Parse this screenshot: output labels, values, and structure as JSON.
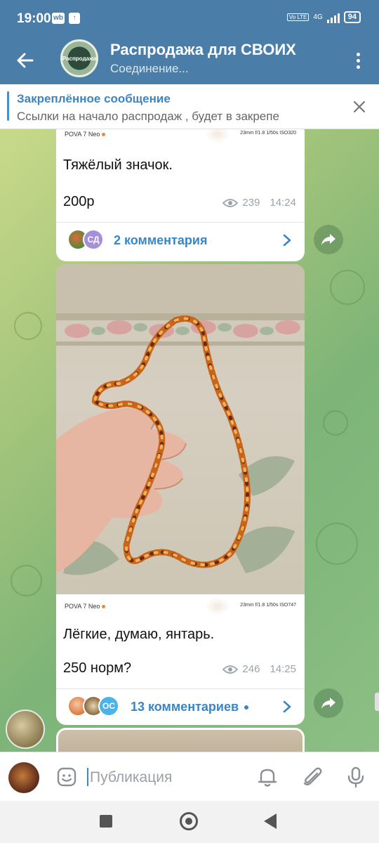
{
  "status_bar": {
    "time": "19:00",
    "app_icon_label": "wb",
    "network": "4G",
    "volte": "Vo LTE",
    "battery": "94"
  },
  "header": {
    "title": "Распродажа для СВОИХ",
    "subtitle": "Соединение...",
    "avatar_text": "Распродажа",
    "accent_color": "#4a7ea8"
  },
  "pinned": {
    "title": "Закреплённое сообщение",
    "text": "Ссылки на начало распродаж , будет в закрепе"
  },
  "messages": [
    {
      "photo_device": "POVA 7 Neo",
      "photo_exif": "23mm f/1.8 1/50s ISO320",
      "line1": "Тяжёлый значок.",
      "line2": "200р",
      "views": "239",
      "time": "14:24",
      "comment_avatar_initials": "СД",
      "comments_label": "2 комментария"
    },
    {
      "photo_device": "POVA 7 Neo",
      "photo_exif": "23mm f/1.8 1/50s ISO747",
      "line1": "Лёгкие, думаю, янтарь.",
      "line2": "250 норм?",
      "views": "246",
      "time": "14:25",
      "comment_avatar_initials": "ОС",
      "comments_label": "13 комментариев"
    }
  ],
  "input": {
    "placeholder": "Публикация"
  },
  "icons": {
    "back": "arrow-left-icon",
    "menu": "more-vertical-icon",
    "close": "close-icon",
    "share": "share-arrow-icon",
    "views": "eye-icon",
    "emoji": "sticker-icon",
    "silent": "bell-icon",
    "attach": "paperclip-icon",
    "mic": "microphone-icon"
  }
}
